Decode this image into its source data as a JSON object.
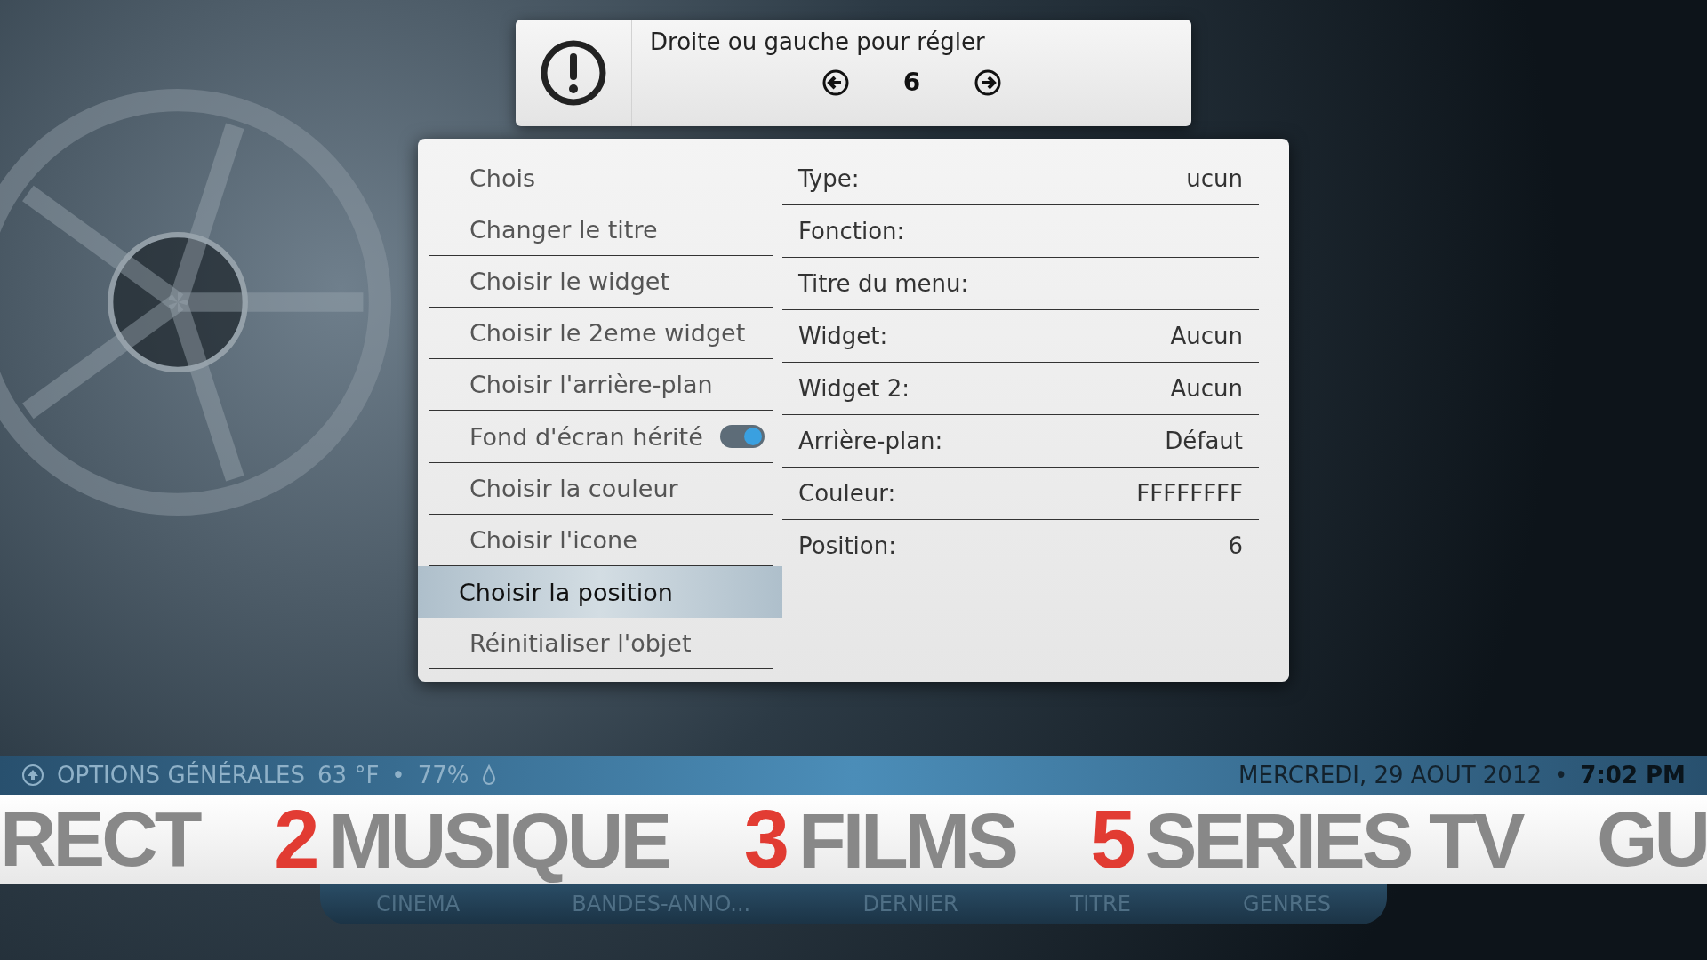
{
  "dialog": {
    "message": "Droite ou gauche pour régler",
    "value": "6"
  },
  "menu": [
    {
      "label": "Chois",
      "kind": "plain",
      "selected": false
    },
    {
      "label": "Changer le titre",
      "kind": "plain",
      "selected": false
    },
    {
      "label": "Choisir le widget",
      "kind": "plain",
      "selected": false
    },
    {
      "label": "Choisir le 2eme widget",
      "kind": "plain",
      "selected": false
    },
    {
      "label": "Choisir l'arrière-plan",
      "kind": "plain",
      "selected": false
    },
    {
      "label": "Fond d'écran hérité",
      "kind": "toggle",
      "on": true,
      "selected": false
    },
    {
      "label": "Choisir la couleur",
      "kind": "plain",
      "selected": false
    },
    {
      "label": "Choisir l'icone",
      "kind": "plain",
      "selected": false
    },
    {
      "label": "Choisir la position",
      "kind": "plain",
      "selected": true
    },
    {
      "label": "Réinitialiser l'objet",
      "kind": "plain",
      "selected": false
    }
  ],
  "properties": [
    {
      "name": "Type:",
      "value": "ucun"
    },
    {
      "name": "Fonction:"
    },
    {
      "name": "Titre du menu:"
    },
    {
      "name": "Widget:",
      "value": "Aucun"
    },
    {
      "name": "Widget 2:",
      "value": "Aucun"
    },
    {
      "name": "Arrière-plan:",
      "value": "Défaut"
    },
    {
      "name": "Couleur:",
      "value": "FFFFFFFF"
    },
    {
      "name": "Position:",
      "value": "6"
    }
  ],
  "status_bar": {
    "section": "OPTIONS GÉNÉRALES",
    "temperature": "63 °F",
    "separator": "•",
    "humidity": "77%",
    "date": "MERCREDI, 29 AOUT 2012",
    "time": "7:02 PM"
  },
  "home_menu": [
    {
      "label": "RECT"
    },
    {
      "label": "MUSIQUE",
      "number": "2"
    },
    {
      "label": "FILMS",
      "number": "3"
    },
    {
      "label": "SERIES TV",
      "number": "5"
    },
    {
      "label": "GU"
    }
  ],
  "submenu": [
    "CINEMA",
    "BANDES-ANNO...",
    "DERNIER",
    "TITRE",
    "GENRES"
  ]
}
